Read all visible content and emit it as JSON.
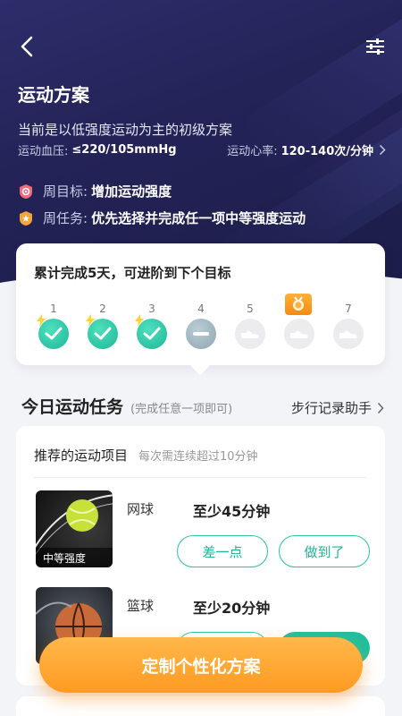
{
  "header": {
    "title": "运动方案",
    "description": "当前是以低强度运动为主的初级方案",
    "blood_pressure_label": "运动血压:",
    "blood_pressure_value": "≤220/105mmHg",
    "heart_rate_label": "运动心率:",
    "heart_rate_value": "120-140次/分钟",
    "week_goal_label": "周目标:",
    "week_goal_value": "增加运动强度",
    "week_task_label": "周任务:",
    "week_task_value": "优先选择并完成任一项中等强度运动"
  },
  "progress": {
    "title": "累计完成5天，可进阶到下个目标",
    "days": [
      {
        "num": "1",
        "state": "done"
      },
      {
        "num": "2",
        "state": "done"
      },
      {
        "num": "3",
        "state": "done"
      },
      {
        "num": "4",
        "state": "current"
      },
      {
        "num": "5",
        "state": "todo"
      },
      {
        "num": "",
        "state": "reward"
      },
      {
        "num": "7",
        "state": "todo"
      }
    ]
  },
  "today": {
    "title": "今日运动任务",
    "subtitle": "(完成任意一项即可)",
    "record_link": "步行记录助手"
  },
  "recommend": {
    "title": "推荐的运动项目",
    "subtitle": "每次需连续超过10分钟"
  },
  "sports": [
    {
      "name": "网球",
      "duration": "至少45分钟",
      "intensity": "中等强度",
      "btn_almost": "差一点",
      "btn_done": "做到了"
    },
    {
      "name": "篮球",
      "duration": "至少20分钟",
      "intensity": "",
      "btn_almost": "",
      "btn_done": ""
    }
  ],
  "cta": {
    "label": "定制个性化方案"
  },
  "colors": {
    "hero_bg": "#242358",
    "accent_green": "#1fbf9f",
    "cta_orange": "#ff9a22"
  }
}
